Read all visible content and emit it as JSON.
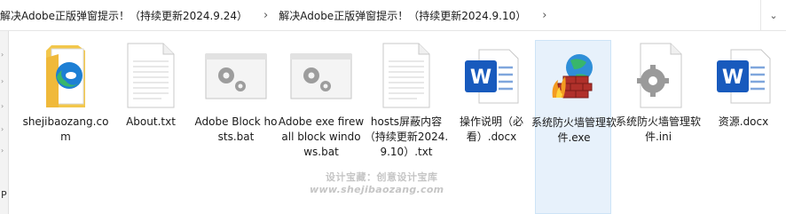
{
  "breadcrumb": {
    "items": [
      "解决Adobe正版弹窗提示！（持续更新2024.9.24）",
      "解决Adobe正版弹窗提示！（持续更新2024.9.10）"
    ],
    "separator": "›",
    "dropdown": "⌄"
  },
  "left_pane": {
    "letter": "P"
  },
  "files": [
    {
      "label": "shejibaozang.com",
      "icon": "edge-shortcut-icon"
    },
    {
      "label": "About.txt",
      "icon": "text-file-icon"
    },
    {
      "label": "Adobe Block hosts.bat",
      "icon": "batch-file-icon"
    },
    {
      "label": "Adobe exe firewall block windows.bat",
      "icon": "batch-file-icon"
    },
    {
      "label": "hosts屏蔽内容（持续更新2024.9.10）.txt",
      "icon": "text-file-icon"
    },
    {
      "label": "操作说明（必看）.docx",
      "icon": "word-document-icon"
    },
    {
      "label": "系统防火墙管理软件.exe",
      "icon": "firewall-exe-icon"
    },
    {
      "label": "系统防火墙管理软件.ini",
      "icon": "settings-file-icon"
    },
    {
      "label": "资源.docx",
      "icon": "word-document-icon"
    }
  ],
  "watermark": {
    "line1": "设计宝藏：创意设计宝库",
    "line2": "www.shejibaozang.com"
  },
  "colors": {
    "word_blue": "#185abd",
    "folder_yellow": "#f3c74b",
    "edge_green": "#38b66b",
    "selection": "#e7f1fb"
  }
}
